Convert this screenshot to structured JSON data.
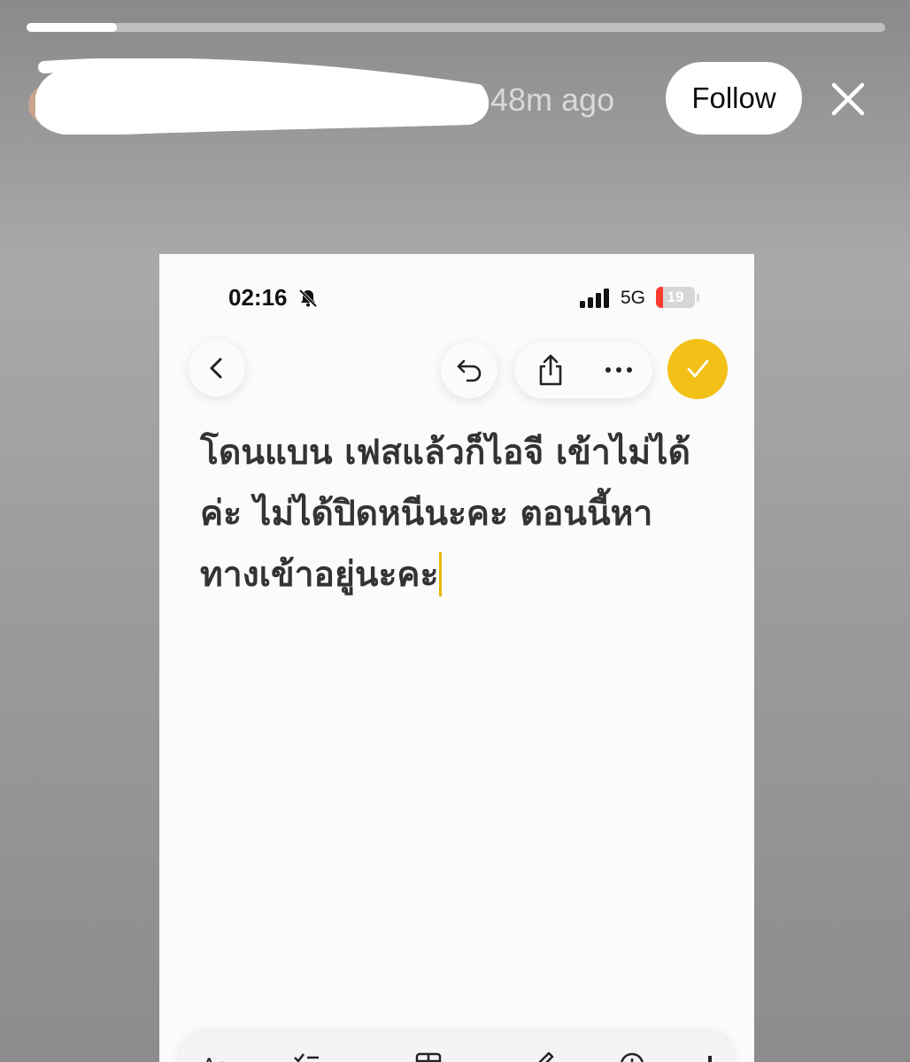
{
  "story": {
    "progress_fraction": 0.105,
    "time_ago": "48m ago",
    "follow_label": "Follow",
    "icons": {
      "close": "close-icon",
      "avatar": "avatar"
    }
  },
  "phone": {
    "status_bar": {
      "time": "02:16",
      "network": "5G",
      "battery": "19",
      "battery_fraction": 0.19,
      "icons": [
        "bell-slash-icon",
        "signal-icon",
        "battery-icon"
      ]
    },
    "toolbar": {
      "icons": [
        "chevron-left-icon",
        "undo-icon",
        "share-icon",
        "more-icon",
        "checkmark-icon"
      ],
      "accent_color": "#f2c016"
    },
    "note": {
      "text": "โดนแบน เฟสแล้วก็ไอจี เข้าไม่ได้\nค่ะ ไม่ได้ปิดหนีนะคะ ตอนนี้หา\nทางเข้าอยู่นะคะ"
    },
    "bottom_toolbar": {
      "icons": [
        "text-format-icon",
        "checklist-icon",
        "table-icon",
        "pen-icon",
        "attachment-icon",
        "more-partial-icon"
      ]
    }
  }
}
